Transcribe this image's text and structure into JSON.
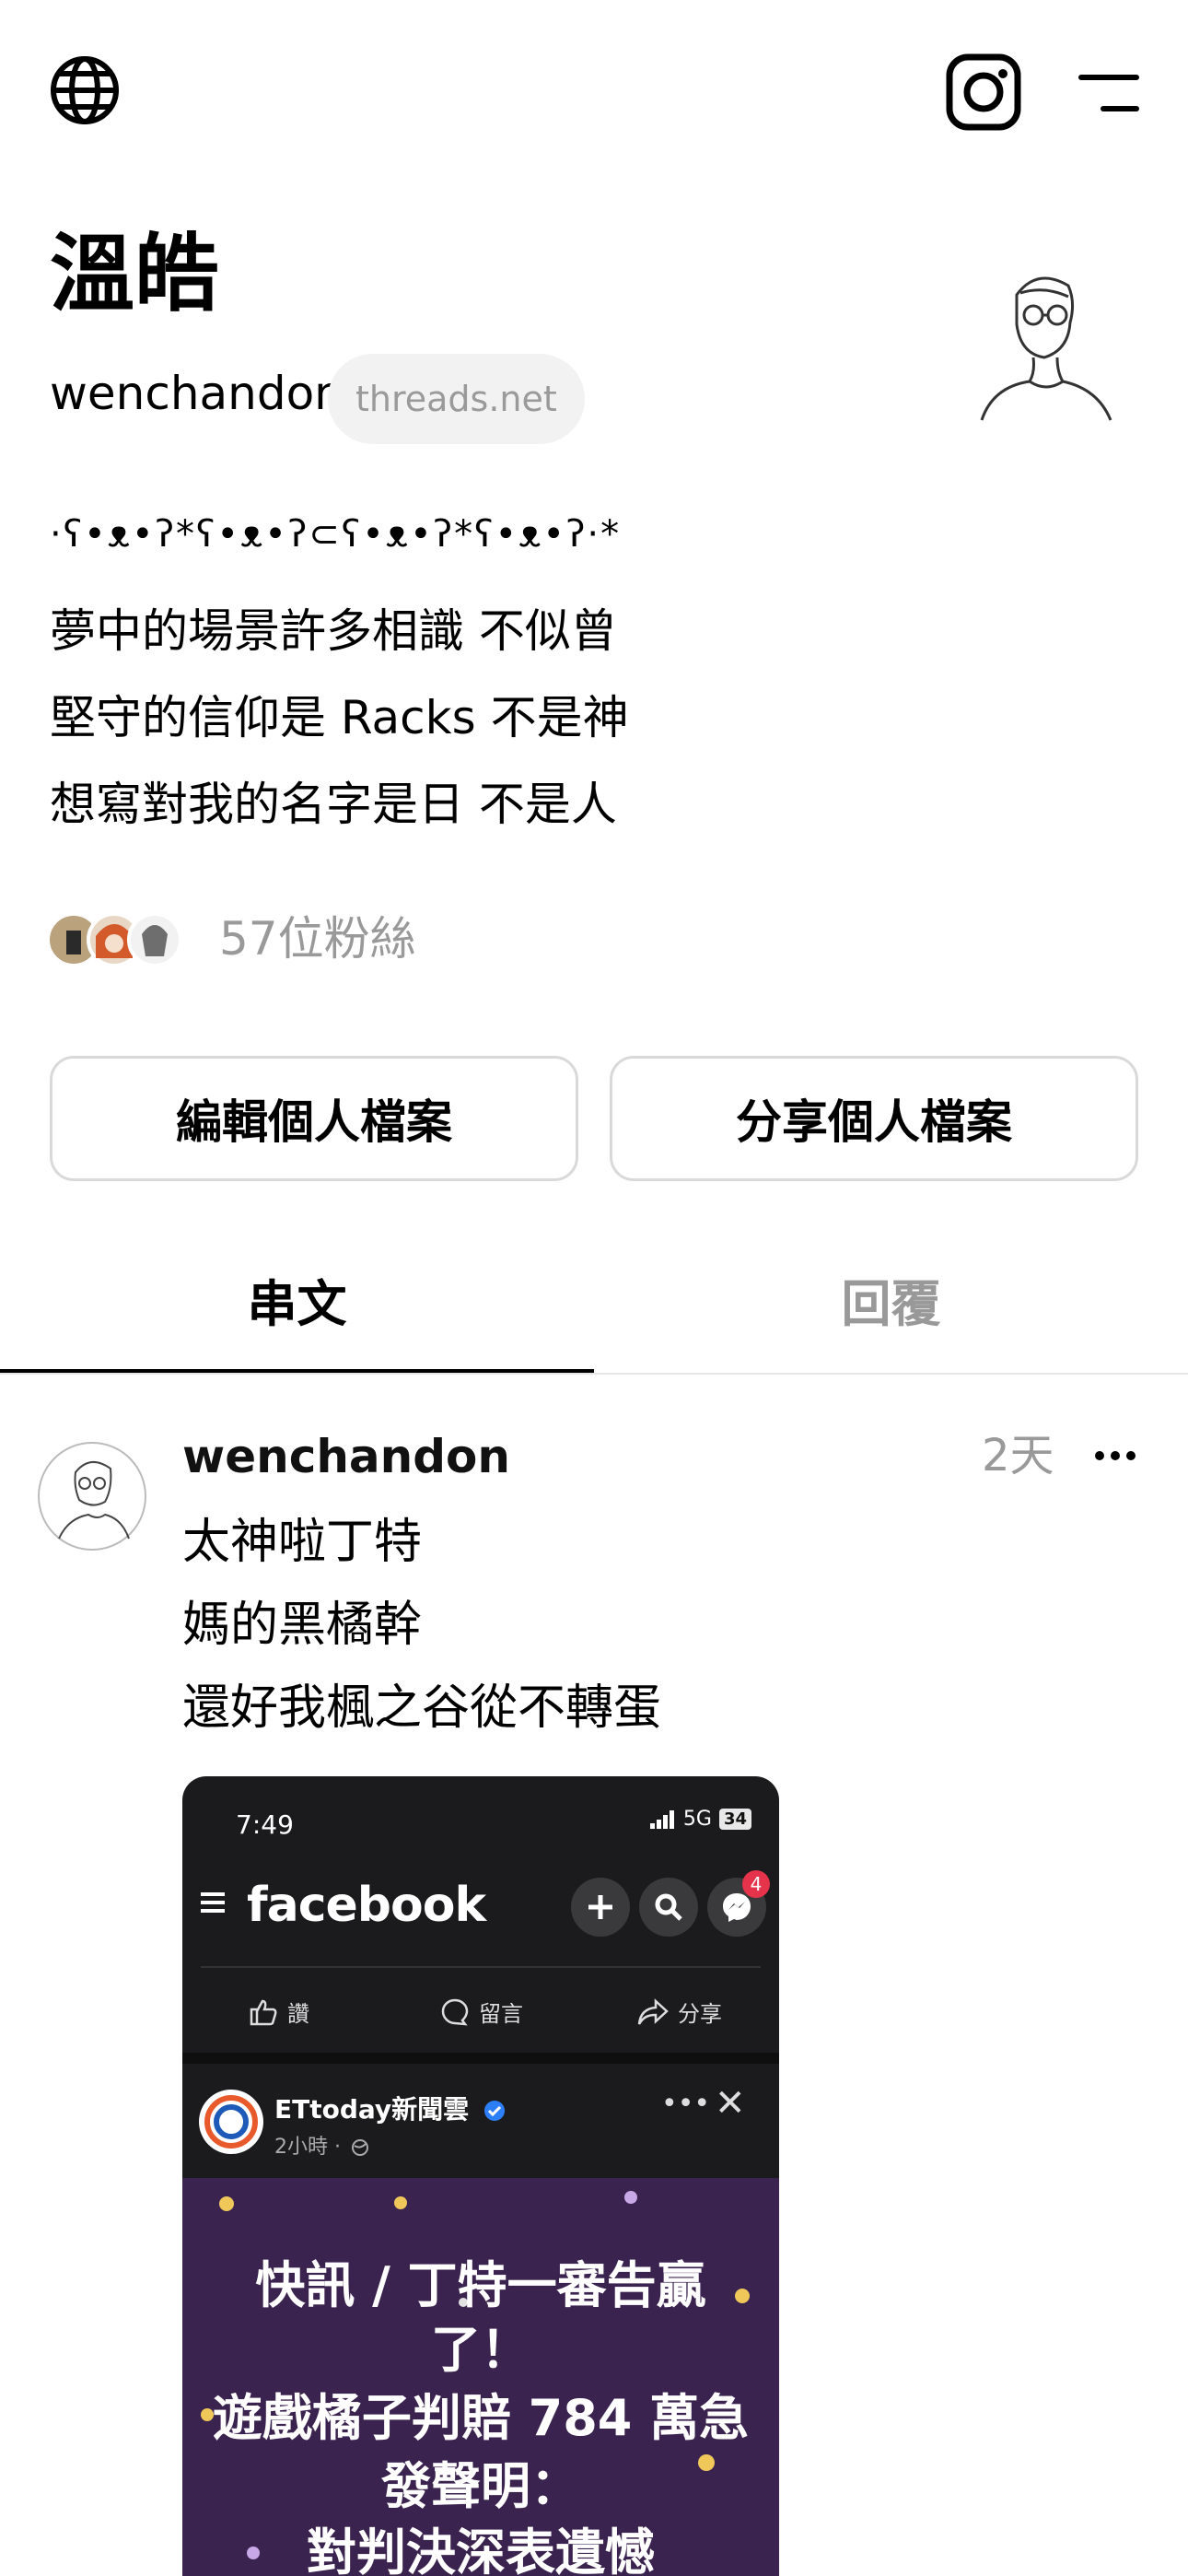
{
  "profile": {
    "name": "溫皓",
    "handle": "wenchandon",
    "domain_badge": "threads.net",
    "bio": {
      "decoration": "·ʕ•ᴥ•ʔ*ʕ•ᴥ•ʔ⊂ʕ•ᴥ•ʔ*ʕ•ᴥ•ʔ·*",
      "line1": "夢中的場景許多相識 不似曾",
      "line2": "堅守的信仰是 Racks 不是神",
      "line3": "想寫對我的名字是日 不是人"
    },
    "followers_label": "57位粉絲",
    "edit_button": "編輯個人檔案",
    "share_button": "分享個人檔案"
  },
  "tabs": [
    {
      "label": "串文",
      "active": true
    },
    {
      "label": "回覆",
      "active": false
    }
  ],
  "post": {
    "username": "wenchandon",
    "time": "2天",
    "lines": [
      "太神啦丁特",
      "媽的黑橘幹",
      "還好我楓之谷從不轉蛋"
    ],
    "embed": {
      "status_time": "7:49",
      "network": "5G",
      "battery": "34",
      "brand": "facebook",
      "notification_count": "4",
      "actions": {
        "like": "讚",
        "comment": "留言",
        "share": "分享"
      },
      "page_name": "ETtoday新聞雲",
      "page_meta": "2小時 ·",
      "poster_lines": [
        "快訊 / 丁特一審告贏",
        "了！",
        "遊戲橘子判賠 784 萬急",
        "發聲明：",
        "對判決深表遺憾"
      ]
    }
  },
  "colors": {
    "text": "#000000",
    "muted": "#999999",
    "pill_bg": "#f2f2f2",
    "button_border": "#d9d9d9",
    "fb_dark": "#1b1b1d",
    "poster_purple": "#3b2350",
    "badge_red": "#e4334a"
  },
  "icons": [
    "globe-icon",
    "instagram-icon",
    "menu-icon",
    "more-icon",
    "verified-icon"
  ]
}
